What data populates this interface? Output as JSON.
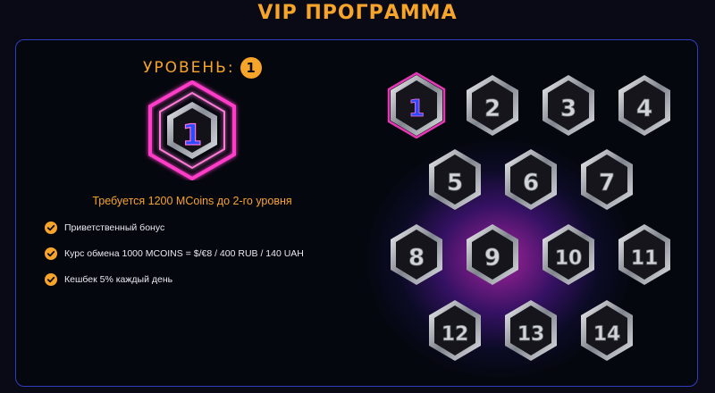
{
  "page": {
    "title": "VIP ПРОГРАММА"
  },
  "current_level": {
    "label": "УРОВЕНЬ:",
    "value": "1"
  },
  "requirement_text": "Требуется 1200 MCoins до 2-го уровня",
  "benefits": [
    {
      "text": "Приветственный бонус"
    },
    {
      "text": "Курс обмена 1000 MCOINS = $/€8 / 400 RUB / 140 UAH"
    },
    {
      "text": "Кешбек 5% каждый день"
    }
  ],
  "levels": [
    {
      "number": "1",
      "status": "current"
    },
    {
      "number": "2",
      "status": "locked"
    },
    {
      "number": "3",
      "status": "locked"
    },
    {
      "number": "4",
      "status": "locked"
    },
    {
      "number": "5",
      "status": "locked"
    },
    {
      "number": "6",
      "status": "locked"
    },
    {
      "number": "7",
      "status": "locked"
    },
    {
      "number": "8",
      "status": "locked"
    },
    {
      "number": "9",
      "status": "locked"
    },
    {
      "number": "10",
      "status": "locked"
    },
    {
      "number": "11",
      "status": "locked"
    },
    {
      "number": "12",
      "status": "locked"
    },
    {
      "number": "13",
      "status": "locked"
    },
    {
      "number": "14",
      "status": "locked"
    }
  ],
  "colors": {
    "accent": "#f7a42b",
    "panel_border": "#2f3dc0",
    "current_level_glow": "#ff3ec8",
    "current_level_number": "#2a4cff",
    "badge_silver": "#c9ccd2"
  }
}
